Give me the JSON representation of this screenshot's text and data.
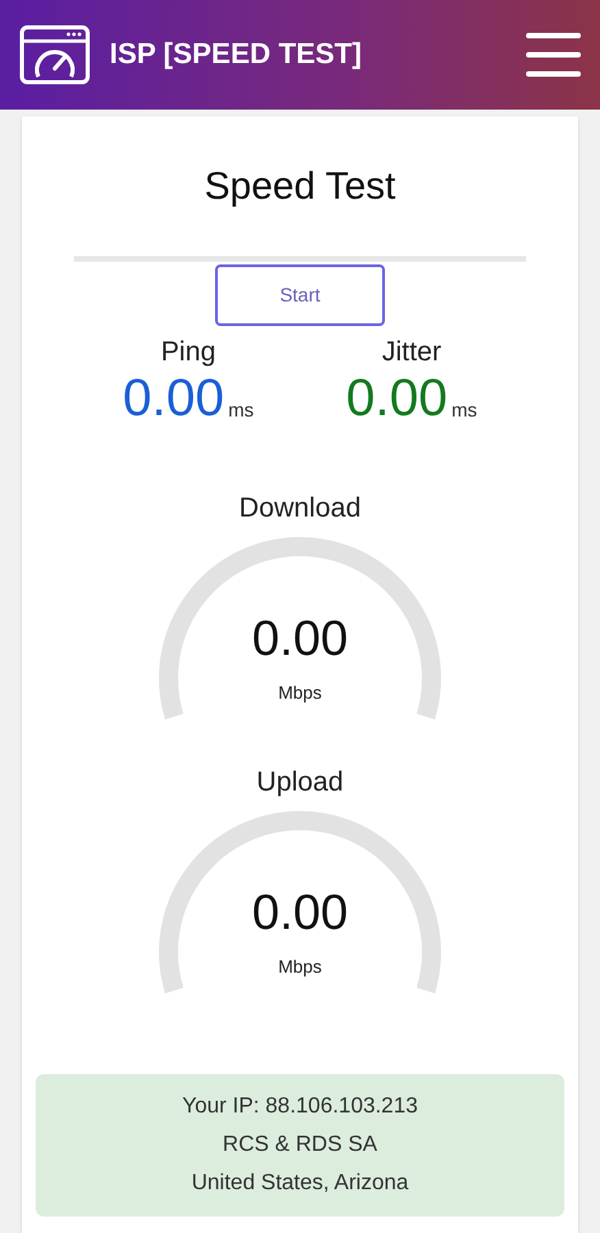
{
  "header": {
    "title": "ISP [SPEED TEST]"
  },
  "card": {
    "title": "Speed Test",
    "start_button": "Start",
    "metrics": [
      {
        "label": "Ping",
        "value": "0.00",
        "unit": "ms",
        "color": "#1a5fd6"
      },
      {
        "label": "Jitter",
        "value": "0.00",
        "unit": "ms",
        "color": "#137a1e"
      }
    ],
    "gauges": [
      {
        "label": "Download",
        "value": "0.00",
        "unit": "Mbps"
      },
      {
        "label": "Upload",
        "value": "0.00",
        "unit": "Mbps"
      }
    ],
    "info": [
      "Your IP: 88.106.103.213",
      "RCS & RDS SA",
      "United States, Arizona"
    ]
  }
}
